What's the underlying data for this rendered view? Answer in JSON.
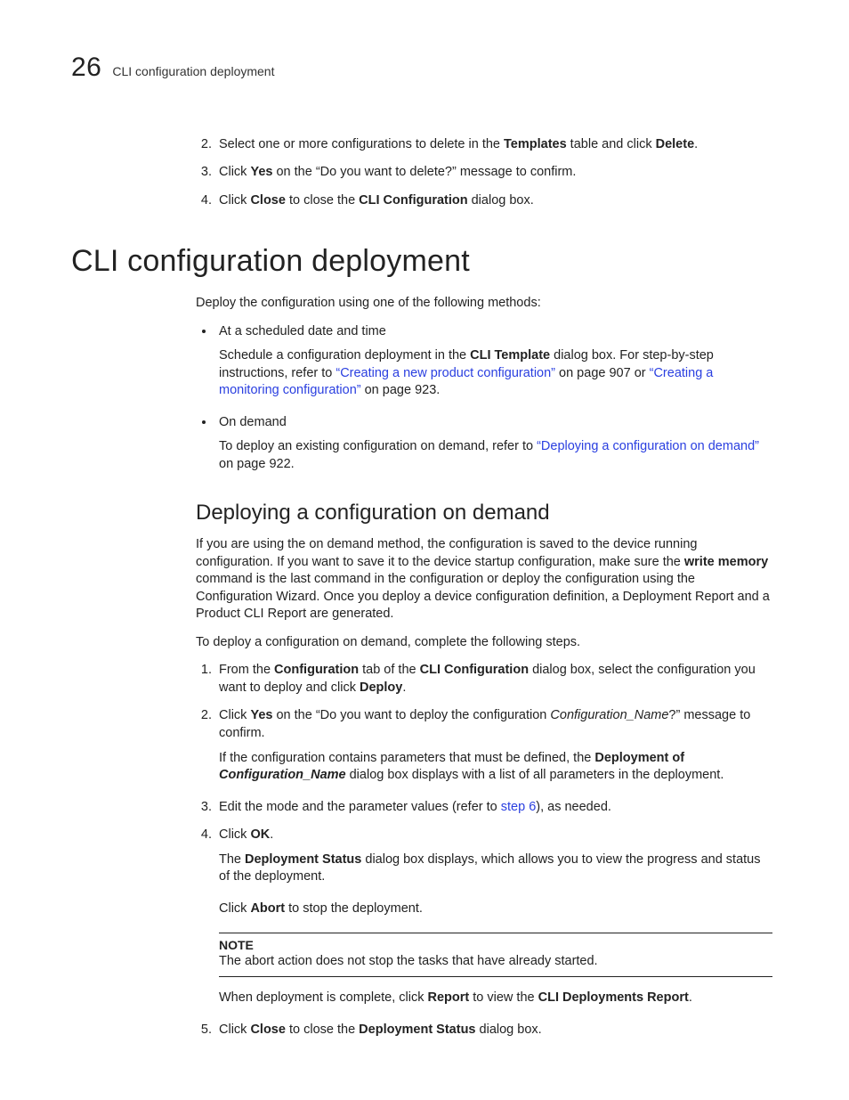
{
  "header": {
    "chapter_number": "26",
    "running_title": "CLI configuration deployment"
  },
  "top_steps": [
    {
      "num": "2.",
      "parts": [
        "Select one or more configurations to delete in the ",
        "Templates",
        " table and click ",
        "Delete",
        "."
      ]
    },
    {
      "num": "3.",
      "parts": [
        "Click ",
        "Yes",
        " on the “Do you want to delete?” message to confirm."
      ]
    },
    {
      "num": "4.",
      "parts": [
        "Click ",
        "Close",
        " to close the ",
        "CLI Configuration",
        " dialog box."
      ]
    }
  ],
  "section": {
    "title": "CLI configuration deployment",
    "intro": "Deploy the configuration using one of the following methods:",
    "bullets": [
      {
        "lead": "At a scheduled date and time",
        "body_parts_a": [
          "Schedule a configuration deployment in the ",
          "CLI Template",
          " dialog box. For step-by-step instructions, refer to "
        ],
        "link_a": "“Creating a new product configuration”",
        "mid_a": " on page 907 or ",
        "link_b": "“Creating a monitoring configuration”",
        "tail_a": " on page 923."
      },
      {
        "lead": "On demand",
        "body_parts_a": [
          "To deploy an existing configuration on demand, refer to "
        ],
        "link_a": "“Deploying a configuration on demand”",
        "tail_a": " on page 922."
      }
    ]
  },
  "subsection": {
    "title": "Deploying a configuration on demand",
    "para1_parts": [
      "If you are using the on demand method, the configuration is saved to the device running configuration. If you want to save it to the device startup configuration, make sure the ",
      "write memory",
      " command is the last command in the configuration or deploy the configuration using the Configuration Wizard. Once you deploy a device configuration definition, a Deployment Report and a Product CLI Report are generated."
    ],
    "para2": "To deploy a configuration on demand, complete the following steps.",
    "steps": [
      {
        "num": "1.",
        "parts": [
          "From the ",
          "Configuration",
          " tab of the ",
          "CLI Configuration",
          " dialog box, select the configuration you want to deploy and click ",
          "Deploy",
          "."
        ]
      },
      {
        "num": "2.",
        "parts": [
          "Click ",
          "Yes",
          " on the “Do you want to deploy the configuration ",
          "Configuration_Name",
          "?” message to confirm."
        ],
        "after_parts": [
          "If the configuration contains parameters that must be defined, the ",
          "Deployment of ",
          "Configuration_Name",
          " dialog box displays with a list of all parameters in the deployment."
        ]
      },
      {
        "num": "3.",
        "parts": [
          "Edit the mode and the parameter values (refer to "
        ],
        "link": "step 6",
        "tail": "), as needed."
      },
      {
        "num": "4.",
        "parts": [
          "Click ",
          "OK",
          "."
        ],
        "after1_parts": [
          "The ",
          "Deployment Status",
          " dialog box displays, which allows you to view the progress and status of the deployment."
        ],
        "after2_parts": [
          "Click ",
          "Abort",
          " to stop the deployment."
        ],
        "note_label": "NOTE",
        "note_body": "The abort action does not stop the tasks that have already started.",
        "after3_parts": [
          "When deployment is complete, click ",
          "Report",
          " to view the ",
          "CLI Deployments Report",
          "."
        ]
      },
      {
        "num": "5.",
        "parts": [
          "Click ",
          "Close",
          " to close the ",
          "Deployment Status",
          " dialog box."
        ]
      }
    ]
  }
}
